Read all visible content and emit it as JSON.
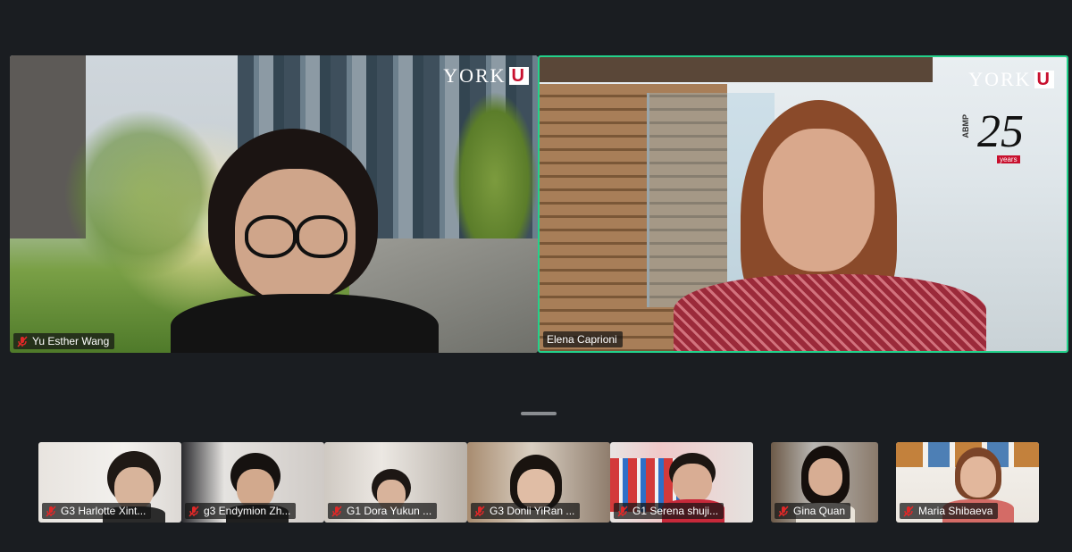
{
  "main_tiles": [
    {
      "name": "Yu Esther Wang",
      "logo_text": "YORK",
      "logo_mark": "U",
      "active": false
    },
    {
      "name": "Elena Caprioni",
      "logo_text": "YORK",
      "logo_mark": "U",
      "badge_org": "ABMP",
      "badge_number": "25",
      "badge_sub": "years",
      "active": true
    }
  ],
  "gallery": [
    {
      "name": "G3 Harlotte Xint..."
    },
    {
      "name": "g3 Endymion Zh..."
    },
    {
      "name": "G1 Dora Yukun ..."
    },
    {
      "name": "G3 Donii YiRan ..."
    },
    {
      "name": "G1 Serena shuji..."
    },
    {
      "name": "Gina Quan"
    },
    {
      "name": "Maria Shibaeva"
    }
  ],
  "icons": {
    "muted": "mic-muted-icon"
  },
  "colors": {
    "active_border": "#23d18b",
    "muted_icon": "#e02828",
    "york_red": "#c8102e"
  }
}
